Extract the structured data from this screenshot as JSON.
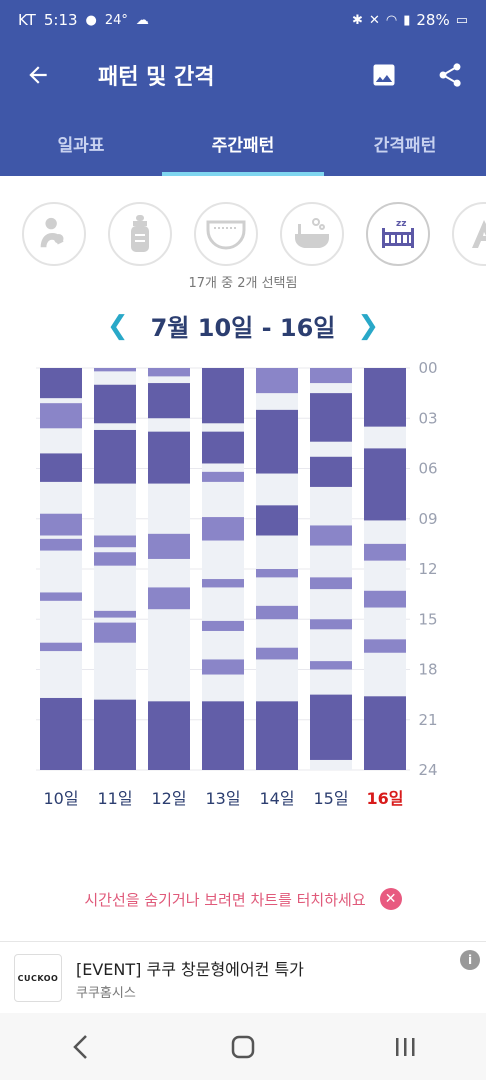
{
  "statusbar": {
    "carrier": "KT",
    "time": "5:13",
    "weather": "24°",
    "battery": "28%"
  },
  "appbar": {
    "title": "패턴 및 간격"
  },
  "tabs": [
    {
      "label": "일과표",
      "active": false
    },
    {
      "label": "주간패턴",
      "active": true
    },
    {
      "label": "간격패턴",
      "active": false
    }
  ],
  "categories": [
    {
      "icon": "feeding-mother-icon",
      "selected": false
    },
    {
      "icon": "bottle-icon",
      "selected": false
    },
    {
      "icon": "diaper-icon",
      "selected": false
    },
    {
      "icon": "bath-icon",
      "selected": false
    },
    {
      "icon": "sleep-crib-icon",
      "selected": true
    },
    {
      "icon": "letter-a-icon",
      "selected": false
    }
  ],
  "selection_text": "17개 중 2개 선택됨",
  "week_label": "7월 10일 - 16일",
  "chart_data": {
    "type": "heatmap",
    "ylim": [
      0,
      24
    ],
    "y_ticks": [
      "00",
      "03",
      "06",
      "09",
      "12",
      "15",
      "18",
      "21",
      "24"
    ],
    "days": [
      {
        "label": "10일",
        "today": false,
        "blocks": [
          [
            0,
            1.8
          ],
          [
            2.1,
            3.6
          ],
          [
            5.1,
            6.8
          ],
          [
            8.7,
            10.0
          ],
          [
            10.2,
            10.9
          ],
          [
            13.4,
            13.9
          ],
          [
            16.4,
            16.9
          ],
          [
            19.7,
            24
          ]
        ]
      },
      {
        "label": "11일",
        "today": false,
        "blocks": [
          [
            0,
            0.2
          ],
          [
            1.0,
            3.3
          ],
          [
            3.7,
            6.9
          ],
          [
            10.0,
            10.7
          ],
          [
            11.0,
            11.8
          ],
          [
            14.5,
            14.9
          ],
          [
            15.2,
            16.4
          ],
          [
            19.8,
            24
          ]
        ]
      },
      {
        "label": "12일",
        "today": false,
        "blocks": [
          [
            0,
            0.5
          ],
          [
            0.9,
            3.0
          ],
          [
            3.8,
            6.9
          ],
          [
            9.9,
            11.4
          ],
          [
            13.1,
            14.4
          ],
          [
            19.9,
            24
          ]
        ]
      },
      {
        "label": "13일",
        "today": false,
        "blocks": [
          [
            0,
            3.3
          ],
          [
            3.8,
            5.7
          ],
          [
            6.2,
            6.8
          ],
          [
            8.9,
            10.3
          ],
          [
            12.6,
            13.1
          ],
          [
            15.1,
            15.7
          ],
          [
            17.4,
            18.3
          ],
          [
            19.9,
            24
          ]
        ]
      },
      {
        "label": "14일",
        "today": false,
        "blocks": [
          [
            0,
            1.5
          ],
          [
            2.5,
            6.3
          ],
          [
            8.2,
            10.0
          ],
          [
            12.0,
            12.5
          ],
          [
            14.2,
            15.0
          ],
          [
            16.7,
            17.4
          ],
          [
            19.9,
            24
          ]
        ]
      },
      {
        "label": "15일",
        "today": false,
        "blocks": [
          [
            0,
            0.9
          ],
          [
            1.5,
            4.4
          ],
          [
            5.3,
            7.1
          ],
          [
            9.4,
            10.6
          ],
          [
            12.5,
            13.2
          ],
          [
            15.0,
            15.6
          ],
          [
            17.5,
            18.0
          ],
          [
            19.5,
            23.4
          ]
        ]
      },
      {
        "label": "16일",
        "today": true,
        "blocks": [
          [
            0,
            3.5
          ],
          [
            4.8,
            9.1
          ],
          [
            10.5,
            11.5
          ],
          [
            13.3,
            14.3
          ],
          [
            16.2,
            17.0
          ],
          [
            19.6,
            24
          ]
        ]
      }
    ]
  },
  "hint": "시간선을 숨기거나 보려면 차트를 터치하세요",
  "ad": {
    "title": "[EVENT] 쿠쿠 창문형에어컨 특가",
    "advertiser": "쿠쿠홈시스",
    "logo_text": "CUCKOO"
  },
  "colors": {
    "primary": "#3f57a8",
    "block": "#625ea8",
    "block_light": "#8a85c8",
    "column_bg": "#eef1f6",
    "today": "#d81b1b"
  }
}
